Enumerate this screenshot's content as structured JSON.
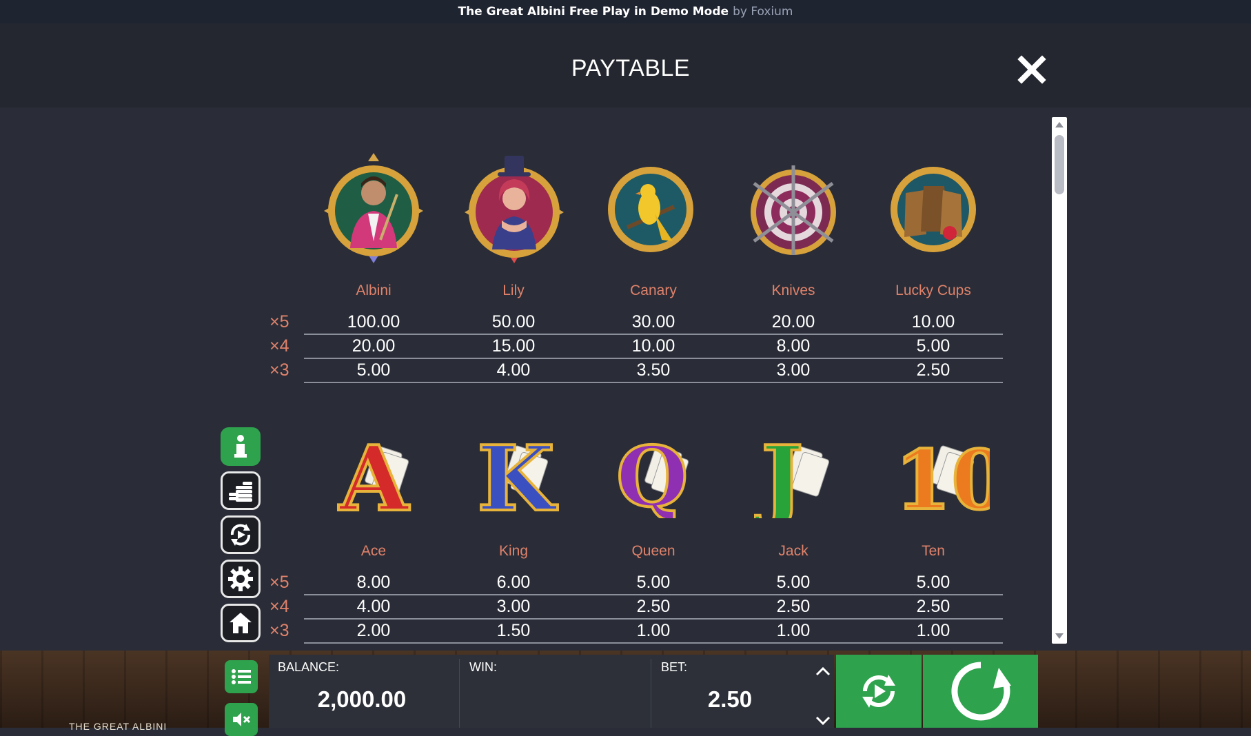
{
  "topbar": {
    "title": "The Great Albini Free Play in Demo Mode",
    "by": "by Foxium"
  },
  "paytable": {
    "title": "PAYTABLE",
    "multipliers": [
      "×5",
      "×4",
      "×3"
    ],
    "group1": {
      "symbols": [
        {
          "name": "Albini",
          "values": [
            "100.00",
            "20.00",
            "5.00"
          ]
        },
        {
          "name": "Lily",
          "values": [
            "50.00",
            "15.00",
            "4.00"
          ]
        },
        {
          "name": "Canary",
          "values": [
            "30.00",
            "10.00",
            "3.50"
          ]
        },
        {
          "name": "Knives",
          "values": [
            "20.00",
            "8.00",
            "3.00"
          ]
        },
        {
          "name": "Lucky Cups",
          "values": [
            "10.00",
            "5.00",
            "2.50"
          ]
        }
      ]
    },
    "group2": {
      "symbols": [
        {
          "name": "Ace",
          "values": [
            "8.00",
            "4.00",
            "2.00"
          ]
        },
        {
          "name": "King",
          "values": [
            "6.00",
            "3.00",
            "1.50"
          ]
        },
        {
          "name": "Queen",
          "values": [
            "5.00",
            "2.50",
            "1.00"
          ]
        },
        {
          "name": "Jack",
          "values": [
            "5.00",
            "2.50",
            "1.00"
          ]
        },
        {
          "name": "Ten",
          "values": [
            "5.00",
            "2.50",
            "1.00"
          ]
        }
      ]
    }
  },
  "bottom": {
    "balance_label": "BALANCE:",
    "balance_value": "2,000.00",
    "win_label": "WIN:",
    "win_value": "",
    "bet_label": "BET:",
    "bet_value": "2.50",
    "logo_text": "THE GREAT ALBINI"
  },
  "colors": {
    "accent_green": "#2fa24e",
    "label_salmon": "#e0826b",
    "panel_dark": "#24272f"
  }
}
